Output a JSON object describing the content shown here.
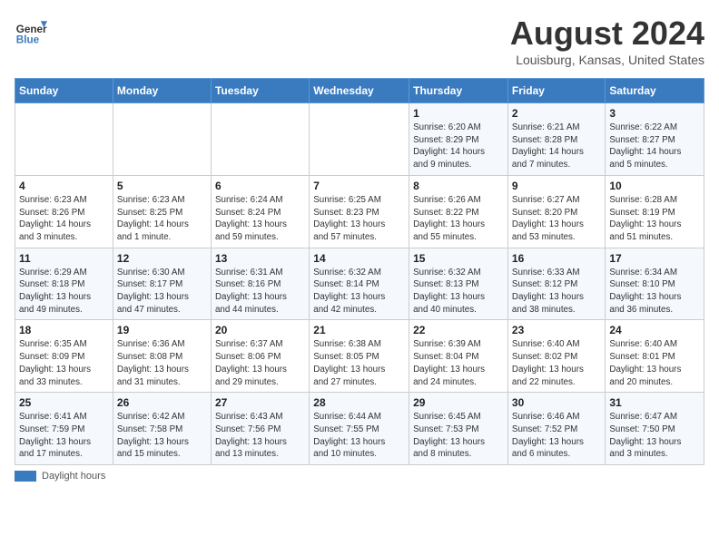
{
  "header": {
    "logo_line1": "General",
    "logo_line2": "Blue",
    "title": "August 2024",
    "subtitle": "Louisburg, Kansas, United States"
  },
  "days_of_week": [
    "Sunday",
    "Monday",
    "Tuesday",
    "Wednesday",
    "Thursday",
    "Friday",
    "Saturday"
  ],
  "weeks": [
    [
      {
        "day": "",
        "info": ""
      },
      {
        "day": "",
        "info": ""
      },
      {
        "day": "",
        "info": ""
      },
      {
        "day": "",
        "info": ""
      },
      {
        "day": "1",
        "info": "Sunrise: 6:20 AM\nSunset: 8:29 PM\nDaylight: 14 hours\nand 9 minutes."
      },
      {
        "day": "2",
        "info": "Sunrise: 6:21 AM\nSunset: 8:28 PM\nDaylight: 14 hours\nand 7 minutes."
      },
      {
        "day": "3",
        "info": "Sunrise: 6:22 AM\nSunset: 8:27 PM\nDaylight: 14 hours\nand 5 minutes."
      }
    ],
    [
      {
        "day": "4",
        "info": "Sunrise: 6:23 AM\nSunset: 8:26 PM\nDaylight: 14 hours\nand 3 minutes."
      },
      {
        "day": "5",
        "info": "Sunrise: 6:23 AM\nSunset: 8:25 PM\nDaylight: 14 hours\nand 1 minute."
      },
      {
        "day": "6",
        "info": "Sunrise: 6:24 AM\nSunset: 8:24 PM\nDaylight: 13 hours\nand 59 minutes."
      },
      {
        "day": "7",
        "info": "Sunrise: 6:25 AM\nSunset: 8:23 PM\nDaylight: 13 hours\nand 57 minutes."
      },
      {
        "day": "8",
        "info": "Sunrise: 6:26 AM\nSunset: 8:22 PM\nDaylight: 13 hours\nand 55 minutes."
      },
      {
        "day": "9",
        "info": "Sunrise: 6:27 AM\nSunset: 8:20 PM\nDaylight: 13 hours\nand 53 minutes."
      },
      {
        "day": "10",
        "info": "Sunrise: 6:28 AM\nSunset: 8:19 PM\nDaylight: 13 hours\nand 51 minutes."
      }
    ],
    [
      {
        "day": "11",
        "info": "Sunrise: 6:29 AM\nSunset: 8:18 PM\nDaylight: 13 hours\nand 49 minutes."
      },
      {
        "day": "12",
        "info": "Sunrise: 6:30 AM\nSunset: 8:17 PM\nDaylight: 13 hours\nand 47 minutes."
      },
      {
        "day": "13",
        "info": "Sunrise: 6:31 AM\nSunset: 8:16 PM\nDaylight: 13 hours\nand 44 minutes."
      },
      {
        "day": "14",
        "info": "Sunrise: 6:32 AM\nSunset: 8:14 PM\nDaylight: 13 hours\nand 42 minutes."
      },
      {
        "day": "15",
        "info": "Sunrise: 6:32 AM\nSunset: 8:13 PM\nDaylight: 13 hours\nand 40 minutes."
      },
      {
        "day": "16",
        "info": "Sunrise: 6:33 AM\nSunset: 8:12 PM\nDaylight: 13 hours\nand 38 minutes."
      },
      {
        "day": "17",
        "info": "Sunrise: 6:34 AM\nSunset: 8:10 PM\nDaylight: 13 hours\nand 36 minutes."
      }
    ],
    [
      {
        "day": "18",
        "info": "Sunrise: 6:35 AM\nSunset: 8:09 PM\nDaylight: 13 hours\nand 33 minutes."
      },
      {
        "day": "19",
        "info": "Sunrise: 6:36 AM\nSunset: 8:08 PM\nDaylight: 13 hours\nand 31 minutes."
      },
      {
        "day": "20",
        "info": "Sunrise: 6:37 AM\nSunset: 8:06 PM\nDaylight: 13 hours\nand 29 minutes."
      },
      {
        "day": "21",
        "info": "Sunrise: 6:38 AM\nSunset: 8:05 PM\nDaylight: 13 hours\nand 27 minutes."
      },
      {
        "day": "22",
        "info": "Sunrise: 6:39 AM\nSunset: 8:04 PM\nDaylight: 13 hours\nand 24 minutes."
      },
      {
        "day": "23",
        "info": "Sunrise: 6:40 AM\nSunset: 8:02 PM\nDaylight: 13 hours\nand 22 minutes."
      },
      {
        "day": "24",
        "info": "Sunrise: 6:40 AM\nSunset: 8:01 PM\nDaylight: 13 hours\nand 20 minutes."
      }
    ],
    [
      {
        "day": "25",
        "info": "Sunrise: 6:41 AM\nSunset: 7:59 PM\nDaylight: 13 hours\nand 17 minutes."
      },
      {
        "day": "26",
        "info": "Sunrise: 6:42 AM\nSunset: 7:58 PM\nDaylight: 13 hours\nand 15 minutes."
      },
      {
        "day": "27",
        "info": "Sunrise: 6:43 AM\nSunset: 7:56 PM\nDaylight: 13 hours\nand 13 minutes."
      },
      {
        "day": "28",
        "info": "Sunrise: 6:44 AM\nSunset: 7:55 PM\nDaylight: 13 hours\nand 10 minutes."
      },
      {
        "day": "29",
        "info": "Sunrise: 6:45 AM\nSunset: 7:53 PM\nDaylight: 13 hours\nand 8 minutes."
      },
      {
        "day": "30",
        "info": "Sunrise: 6:46 AM\nSunset: 7:52 PM\nDaylight: 13 hours\nand 6 minutes."
      },
      {
        "day": "31",
        "info": "Sunrise: 6:47 AM\nSunset: 7:50 PM\nDaylight: 13 hours\nand 3 minutes."
      }
    ]
  ],
  "legend": {
    "color_label": "Daylight hours",
    "color": "#3a7abf"
  }
}
